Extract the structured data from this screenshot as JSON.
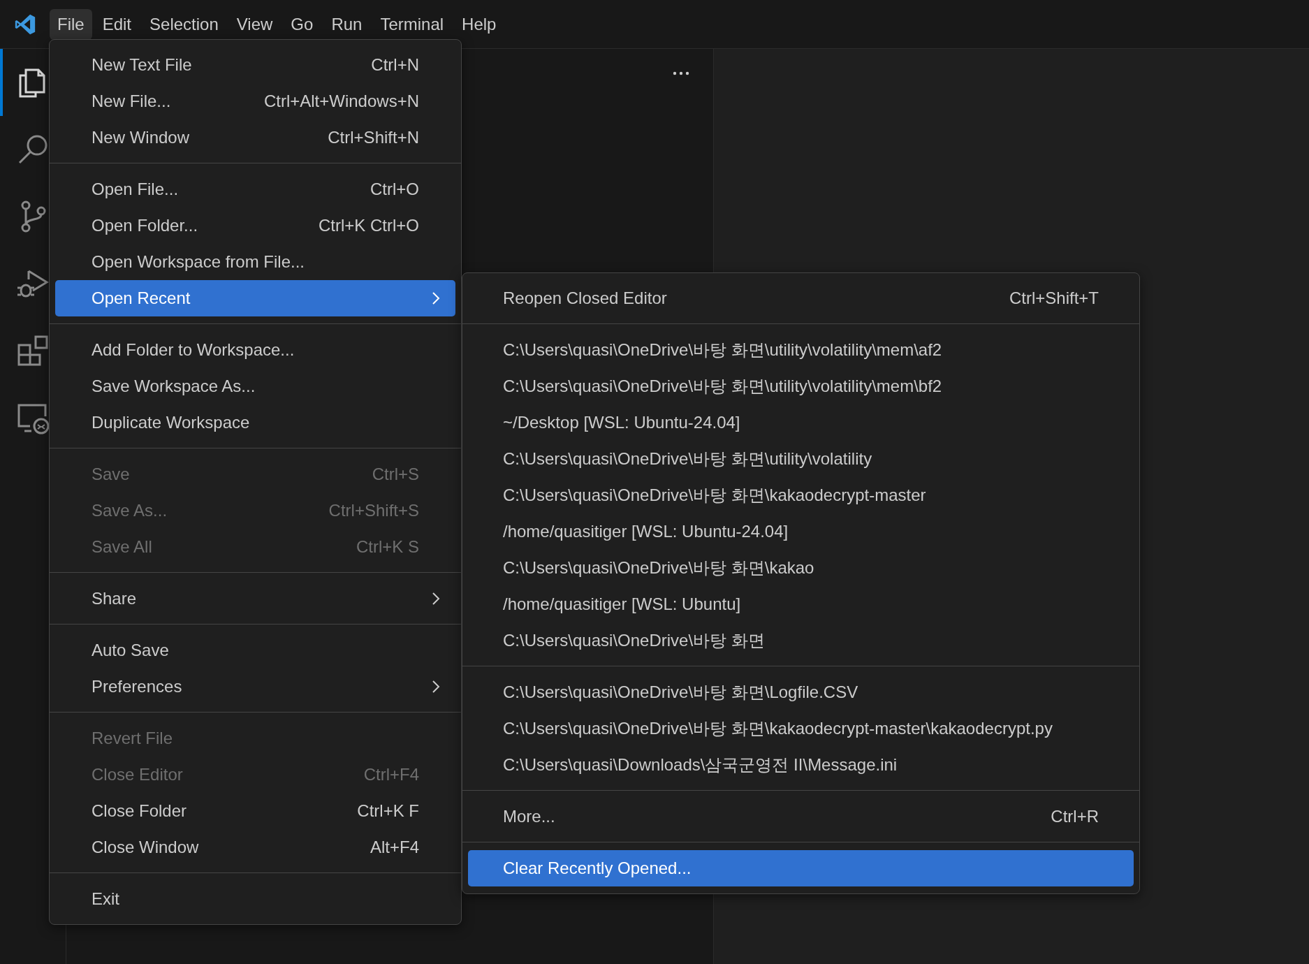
{
  "menubar": [
    {
      "label": "File",
      "selected": true
    },
    {
      "label": "Edit",
      "selected": false
    },
    {
      "label": "Selection",
      "selected": false
    },
    {
      "label": "View",
      "selected": false
    },
    {
      "label": "Go",
      "selected": false
    },
    {
      "label": "Run",
      "selected": false
    },
    {
      "label": "Terminal",
      "selected": false
    },
    {
      "label": "Help",
      "selected": false
    }
  ],
  "activity_bar": [
    {
      "kind": "explorer",
      "selected": true
    },
    {
      "kind": "search",
      "selected": false
    },
    {
      "kind": "source-control",
      "selected": false
    },
    {
      "kind": "run-debug",
      "selected": false
    },
    {
      "kind": "extensions",
      "selected": false
    },
    {
      "kind": "remote",
      "selected": false
    }
  ],
  "file_menu": {
    "groups": [
      [
        {
          "label": "New Text File",
          "shortcut": "Ctrl+N",
          "disabled": false,
          "selected": false,
          "submenu": false
        },
        {
          "label": "New File...",
          "shortcut": "Ctrl+Alt+Windows+N",
          "disabled": false,
          "selected": false,
          "submenu": false
        },
        {
          "label": "New Window",
          "shortcut": "Ctrl+Shift+N",
          "disabled": false,
          "selected": false,
          "submenu": false
        }
      ],
      [
        {
          "label": "Open File...",
          "shortcut": "Ctrl+O",
          "disabled": false,
          "selected": false,
          "submenu": false
        },
        {
          "label": "Open Folder...",
          "shortcut": "Ctrl+K Ctrl+O",
          "disabled": false,
          "selected": false,
          "submenu": false
        },
        {
          "label": "Open Workspace from File...",
          "disabled": false,
          "selected": false,
          "submenu": false
        },
        {
          "label": "Open Recent",
          "disabled": false,
          "selected": true,
          "submenu": true
        }
      ],
      [
        {
          "label": "Add Folder to Workspace...",
          "disabled": false,
          "selected": false,
          "submenu": false
        },
        {
          "label": "Save Workspace As...",
          "disabled": false,
          "selected": false,
          "submenu": false
        },
        {
          "label": "Duplicate Workspace",
          "disabled": false,
          "selected": false,
          "submenu": false
        }
      ],
      [
        {
          "label": "Save",
          "shortcut": "Ctrl+S",
          "disabled": true,
          "selected": false,
          "submenu": false
        },
        {
          "label": "Save As...",
          "shortcut": "Ctrl+Shift+S",
          "disabled": true,
          "selected": false,
          "submenu": false
        },
        {
          "label": "Save All",
          "shortcut": "Ctrl+K S",
          "disabled": true,
          "selected": false,
          "submenu": false
        }
      ],
      [
        {
          "label": "Share",
          "disabled": false,
          "selected": false,
          "submenu": true
        }
      ],
      [
        {
          "label": "Auto Save",
          "disabled": false,
          "selected": false,
          "submenu": false
        },
        {
          "label": "Preferences",
          "disabled": false,
          "selected": false,
          "submenu": true
        }
      ],
      [
        {
          "label": "Revert File",
          "disabled": true,
          "selected": false,
          "submenu": false
        },
        {
          "label": "Close Editor",
          "shortcut": "Ctrl+F4",
          "disabled": true,
          "selected": false,
          "submenu": false
        },
        {
          "label": "Close Folder",
          "shortcut": "Ctrl+K F",
          "disabled": false,
          "selected": false,
          "submenu": false
        },
        {
          "label": "Close Window",
          "shortcut": "Alt+F4",
          "disabled": false,
          "selected": false,
          "submenu": false
        }
      ],
      [
        {
          "label": "Exit",
          "disabled": false,
          "selected": false,
          "submenu": false
        }
      ]
    ]
  },
  "open_recent_menu": {
    "groups": [
      [
        {
          "label": "Reopen Closed Editor",
          "shortcut": "Ctrl+Shift+T",
          "selected": false
        }
      ],
      [
        {
          "label": "C:\\Users\\quasi\\OneDrive\\바탕 화면\\utility\\volatility\\mem\\af2",
          "selected": false
        },
        {
          "label": "C:\\Users\\quasi\\OneDrive\\바탕 화면\\utility\\volatility\\mem\\bf2",
          "selected": false
        },
        {
          "label": "~/Desktop [WSL: Ubuntu-24.04]",
          "selected": false
        },
        {
          "label": "C:\\Users\\quasi\\OneDrive\\바탕 화면\\utility\\volatility",
          "selected": false
        },
        {
          "label": "C:\\Users\\quasi\\OneDrive\\바탕 화면\\kakaodecrypt-master",
          "selected": false
        },
        {
          "label": "/home/quasitiger [WSL: Ubuntu-24.04]",
          "selected": false
        },
        {
          "label": "C:\\Users\\quasi\\OneDrive\\바탕 화면\\kakao",
          "selected": false
        },
        {
          "label": "/home/quasitiger [WSL: Ubuntu]",
          "selected": false
        },
        {
          "label": "C:\\Users\\quasi\\OneDrive\\바탕 화면",
          "selected": false
        }
      ],
      [
        {
          "label": "C:\\Users\\quasi\\OneDrive\\바탕 화면\\Logfile.CSV",
          "selected": false
        },
        {
          "label": "C:\\Users\\quasi\\OneDrive\\바탕 화면\\kakaodecrypt-master\\kakaodecrypt.py",
          "selected": false
        },
        {
          "label": "C:\\Users\\quasi\\Downloads\\삼국군영전 II\\Message.ini",
          "selected": false
        }
      ],
      [
        {
          "label": "More...",
          "shortcut": "Ctrl+R",
          "selected": false
        }
      ],
      [
        {
          "label": "Clear Recently Opened...",
          "selected": true
        }
      ]
    ]
  }
}
